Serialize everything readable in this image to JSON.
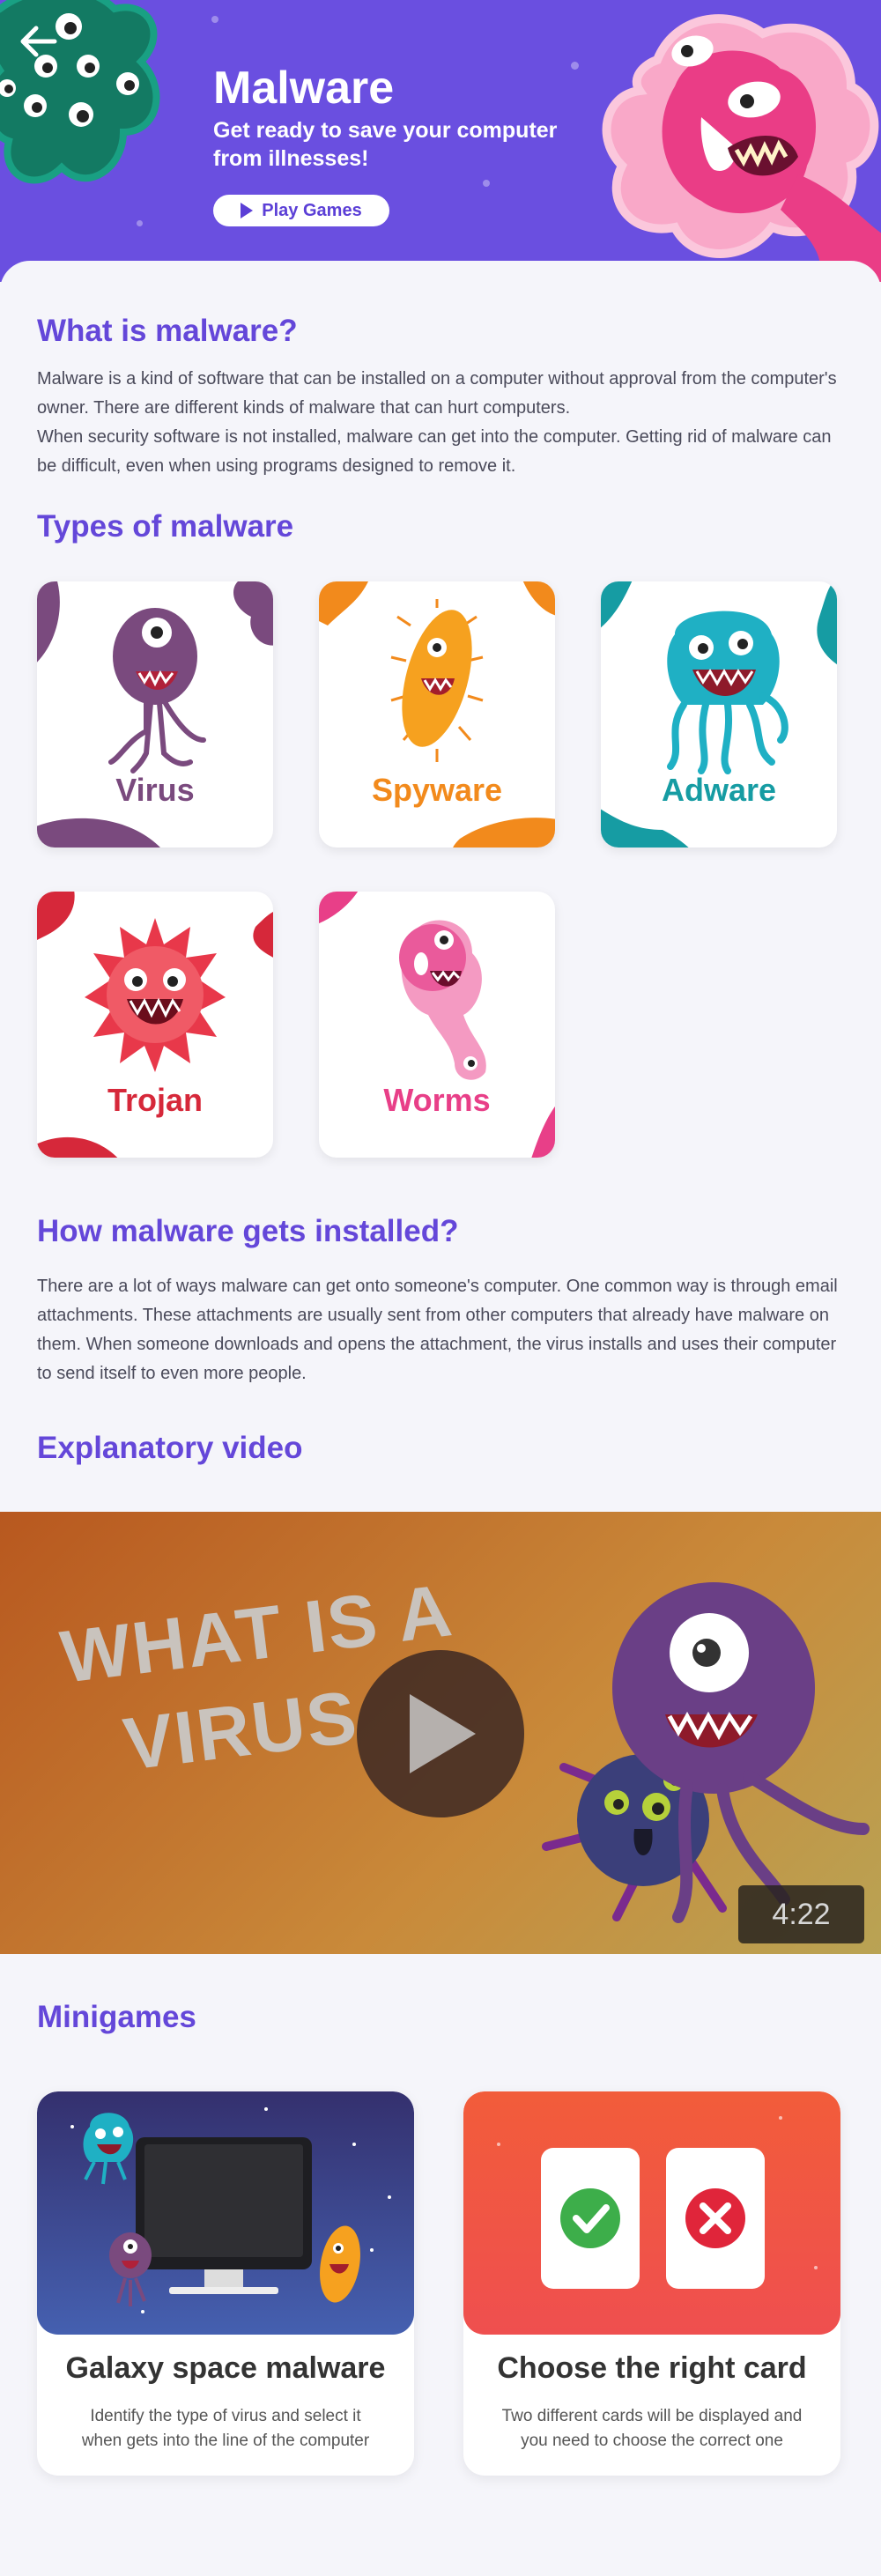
{
  "header": {
    "title": "Malware",
    "subtitle": "Get ready to save your computer from illnesses!",
    "play_button": "Play Games",
    "back_icon": "arrow-left-icon"
  },
  "intro": {
    "heading": "What is malware?",
    "text": "Malware is a kind of software that can be installed on a computer without approval from the computer's owner. There are different kinds of malware that can hurt computers.",
    "text2": "When security software is not installed, malware can get into the computer. Getting rid of malware can be difficult, even when using programs designed to remove it."
  },
  "types": {
    "heading": "Types of malware",
    "items": [
      {
        "label": "Virus",
        "color": "#7a4a7e"
      },
      {
        "label": "Spyware",
        "color": "#f28a1c"
      },
      {
        "label": "Adware",
        "color": "#169ca3"
      },
      {
        "label": "Trojan",
        "color": "#d6283a"
      },
      {
        "label": "Worms",
        "color": "#e83f88"
      }
    ]
  },
  "install": {
    "heading": "How malware gets installed?",
    "text": "There are a lot of ways malware can get onto someone's computer. One common way is through email attachments. These attachments are usually sent from other computers that already have malware on them. When someone downloads and opens the attachment, the virus installs and uses their computer to send itself to even more people."
  },
  "video": {
    "heading": "Explanatory video",
    "thumbnail_line1": "WHAT IS A",
    "thumbnail_line2": "VIRUS",
    "duration": "4:22",
    "play_icon": "play-icon"
  },
  "minigames": {
    "heading": "Minigames",
    "games": [
      {
        "title": "Galaxy space malware",
        "description": "Identify the type of virus and select it when gets into the line of the computer"
      },
      {
        "title": "Choose the right card",
        "description": "Two different cards will be displayed and you need to choose the correct one"
      }
    ]
  },
  "colors": {
    "primary": "#6a4fe0",
    "heading": "#6447d9",
    "background": "#f5f5fa"
  }
}
